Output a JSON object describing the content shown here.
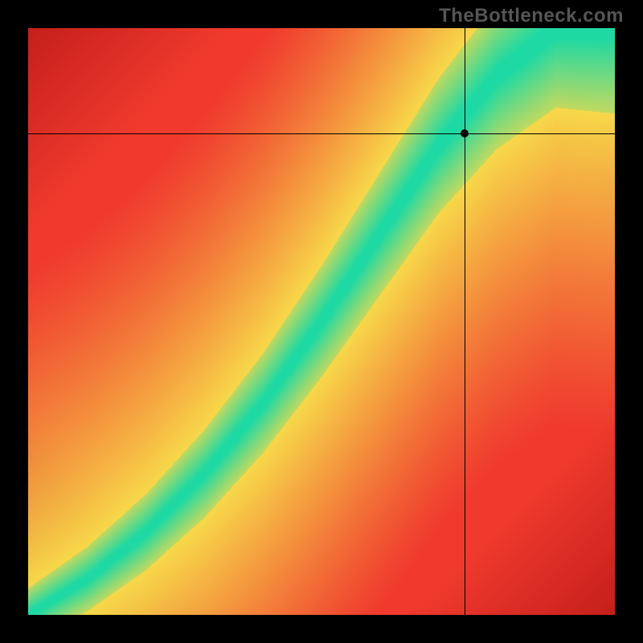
{
  "watermark": "TheBottleneck.com",
  "chart_data": {
    "type": "heatmap",
    "title": "",
    "xlabel": "",
    "ylabel": "",
    "xlim": [
      0,
      1
    ],
    "ylim": [
      0,
      1
    ],
    "grid": false,
    "value_scale": "red (poor) → yellow → green (optimal)",
    "crosshair": {
      "x": 0.745,
      "y": 0.82
    },
    "marker": {
      "x": 0.745,
      "y": 0.82
    },
    "ridge_curve_description": "green optimal band following a superlinear curve from bottom-left to top-right, steepening past x≈0.5",
    "ridge_samples": [
      {
        "x": 0.0,
        "y": 0.0
      },
      {
        "x": 0.1,
        "y": 0.06
      },
      {
        "x": 0.2,
        "y": 0.14
      },
      {
        "x": 0.3,
        "y": 0.24
      },
      {
        "x": 0.4,
        "y": 0.36
      },
      {
        "x": 0.5,
        "y": 0.5
      },
      {
        "x": 0.6,
        "y": 0.65
      },
      {
        "x": 0.7,
        "y": 0.8
      },
      {
        "x": 0.8,
        "y": 0.92
      },
      {
        "x": 0.9,
        "y": 1.0
      }
    ],
    "colors": {
      "low": "#F03A2E",
      "mid": "#F8D94A",
      "high": "#1FD9A4"
    }
  }
}
